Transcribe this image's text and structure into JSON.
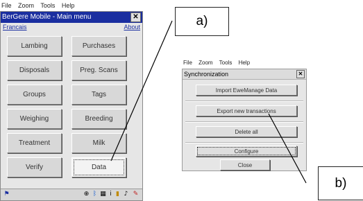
{
  "main_window": {
    "menubar": [
      "File",
      "Zoom",
      "Tools",
      "Help"
    ],
    "title": "BerGere Mobile - Main menu",
    "close_glyph": "✕",
    "links": {
      "language": "Francais",
      "about": "About"
    },
    "buttons": [
      "Lambing",
      "Purchases",
      "Disposals",
      "Preg. Scans",
      "Groups",
      "Tags",
      "Weighing",
      "Breeding",
      "Treatment",
      "Milk",
      "Verify",
      "Data"
    ],
    "focused_button": "Data",
    "taskbar_icons": [
      "start-flag-icon",
      "network-icon",
      "bluetooth-icon",
      "keyboard-icon",
      "info-icon",
      "battery-icon",
      "speaker-icon",
      "pen-icon"
    ]
  },
  "sync_window": {
    "menubar": [
      "File",
      "Zoom",
      "Tools",
      "Help"
    ],
    "title": "Synchronization",
    "close_glyph": "✕",
    "buttons": {
      "import": "Import EweManage Data",
      "export": "Export new transactions",
      "delete": "Delete all",
      "configure": "Configure",
      "close": "Close"
    }
  },
  "callouts": {
    "a": "a)",
    "b": "b)"
  },
  "colors": {
    "title_bar": "#1a2ea0",
    "link": "#1a2ea0",
    "button_face": "#d8d8d8",
    "window_bg": "#e6e6e6"
  }
}
